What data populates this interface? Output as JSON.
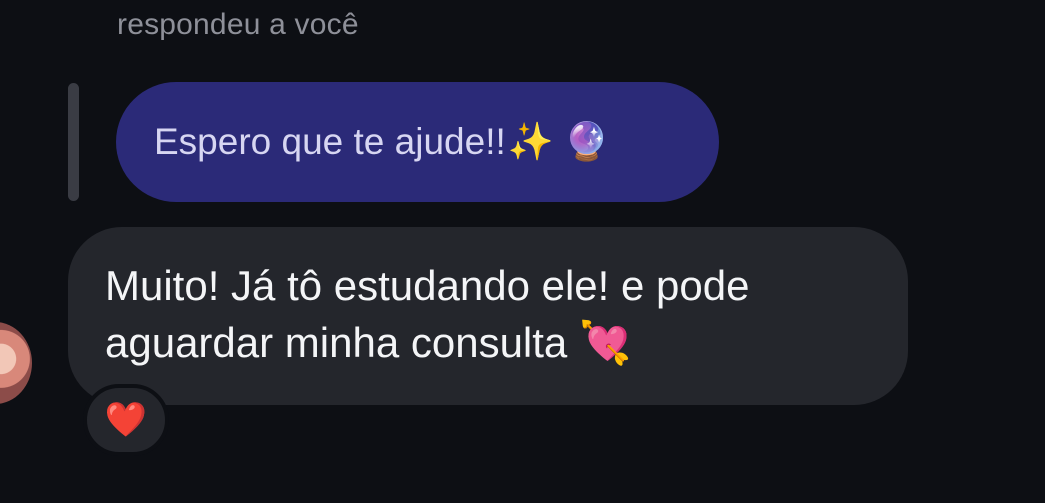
{
  "header": {
    "reply_label": "respondeu a você"
  },
  "quoted_message": {
    "text": "Espero que te ajude!!",
    "sparkle_emoji": "✨",
    "crystal_ball_emoji": "🔮"
  },
  "message": {
    "line1": "Muito! Já tô estudando ele! e pode",
    "line2": "aguardar minha consulta",
    "heart_arrow_emoji": "💘"
  },
  "reaction": {
    "emoji": "❤️"
  }
}
